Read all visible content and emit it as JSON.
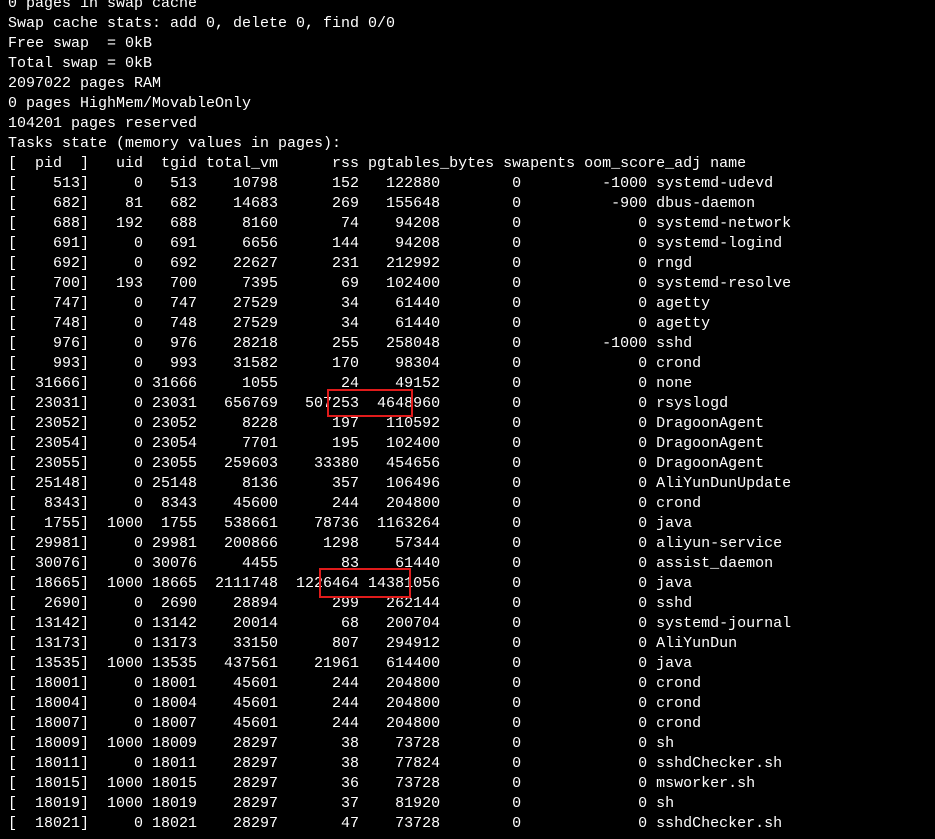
{
  "terminal": {
    "fg_color": "#ffffff",
    "bg_color": "#000000",
    "highlight_color": "#e01b1b",
    "lines": [
      "0 pages in swap cache",
      "Swap cache stats: add 0, delete 0, find 0/0",
      "Free swap  = 0kB",
      "Total swap = 0kB",
      "2097022 pages RAM",
      "0 pages HighMem/MovableOnly",
      "104201 pages reserved",
      "Tasks state (memory values in pages):",
      "[  pid  ]   uid  tgid total_vm      rss pgtables_bytes swapents oom_score_adj name",
      "[    513]     0   513    10798      152   122880        0         -1000 systemd-udevd",
      "[    682]    81   682    14683      269   155648        0          -900 dbus-daemon",
      "[    688]   192   688     8160       74    94208        0             0 systemd-network",
      "[    691]     0   691     6656      144    94208        0             0 systemd-logind",
      "[    692]     0   692    22627      231   212992        0             0 rngd",
      "[    700]   193   700     7395       69   102400        0             0 systemd-resolve",
      "[    747]     0   747    27529       34    61440        0             0 agetty",
      "[    748]     0   748    27529       34    61440        0             0 agetty",
      "[    976]     0   976    28218      255   258048        0         -1000 sshd",
      "[    993]     0   993    31582      170    98304        0             0 crond",
      "[  31666]     0 31666     1055       24    49152        0             0 none",
      "[  23031]     0 23031   656769   507253  4648960        0             0 rsyslogd",
      "[  23052]     0 23052     8228      197   110592        0             0 DragoonAgent",
      "[  23054]     0 23054     7701      195   102400        0             0 DragoonAgent",
      "[  23055]     0 23055   259603    33380   454656        0             0 DragoonAgent",
      "[  25148]     0 25148     8136      357   106496        0             0 AliYunDunUpdate",
      "[   8343]     0  8343    45600      244   204800        0             0 crond",
      "[   1755]  1000  1755   538661    78736  1163264        0             0 java",
      "[  29981]     0 29981   200866     1298    57344        0             0 aliyun-service",
      "[  30076]     0 30076     4455       83    61440        0             0 assist_daemon",
      "[  18665]  1000 18665  2111748  1226464 14381056        0             0 java",
      "[   2690]     0  2690    28894      299   262144        0             0 sshd",
      "[  13142]     0 13142    20014       68   200704        0             0 systemd-journal",
      "[  13173]     0 13173    33150      807   294912        0             0 AliYunDun",
      "[  13535]  1000 13535   437561    21961   614400        0             0 java",
      "[  18001]     0 18001    45601      244   204800        0             0 crond",
      "[  18004]     0 18004    45601      244   204800        0             0 crond",
      "[  18007]     0 18007    45601      244   204800        0             0 crond",
      "[  18009]  1000 18009    28297       38    73728        0             0 sh",
      "[  18011]     0 18011    28297       38    77824        0             0 sshdChecker.sh",
      "[  18015]  1000 18015    28297       36    73728        0             0 msworker.sh",
      "[  18019]  1000 18019    28297       37    81920        0             0 sh",
      "[  18021]     0 18021    28297       47    73728        0             0 sshdChecker.sh"
    ]
  }
}
